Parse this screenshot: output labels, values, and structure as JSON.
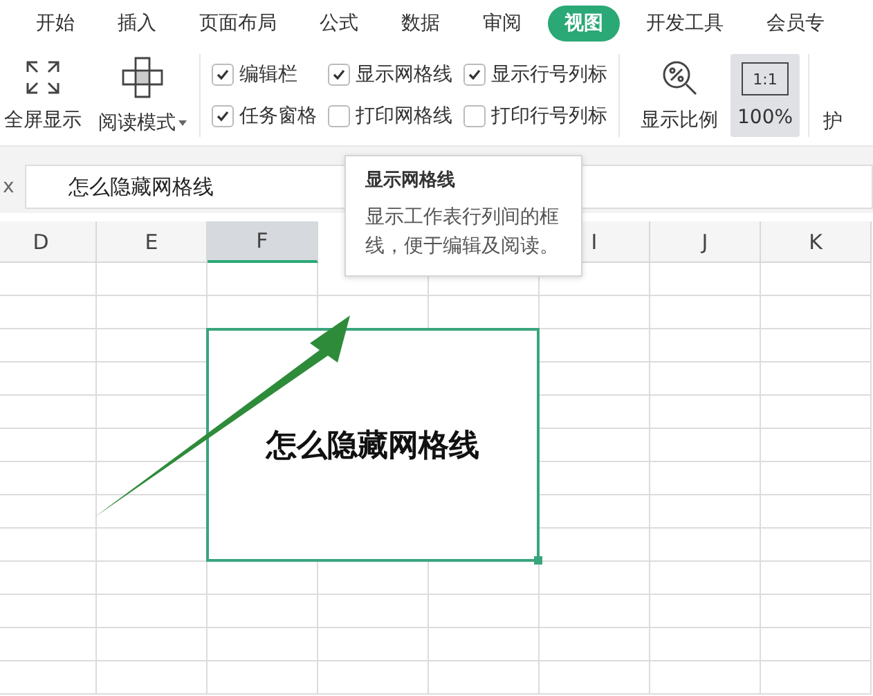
{
  "tabs": [
    {
      "label": "开始",
      "selected": false
    },
    {
      "label": "插入",
      "selected": false
    },
    {
      "label": "页面布局",
      "selected": false
    },
    {
      "label": "公式",
      "selected": false
    },
    {
      "label": "数据",
      "selected": false
    },
    {
      "label": "审阅",
      "selected": false
    },
    {
      "label": "视图",
      "selected": true
    },
    {
      "label": "开发工具",
      "selected": false
    },
    {
      "label": "会员专",
      "selected": false
    }
  ],
  "ribbon": {
    "fullscreen": {
      "label": "全屏显示"
    },
    "reading_mode": {
      "label": "阅读模式"
    },
    "checkboxes": [
      {
        "label": "编辑栏",
        "checked": true
      },
      {
        "label": "任务窗格",
        "checked": true
      },
      {
        "label": "显示网格线",
        "checked": true
      },
      {
        "label": "打印网格线",
        "checked": false
      },
      {
        "label": "显示行号列标",
        "checked": true
      },
      {
        "label": "打印行号列标",
        "checked": false
      }
    ],
    "zoom": {
      "label": "显示比例"
    },
    "actual_size": {
      "icon_text": "1:1",
      "label": "100%",
      "selected": true
    },
    "cut_item": {
      "label": "护"
    }
  },
  "formula_bar": {
    "fx_label": "x",
    "value": "怎么隐藏网格线"
  },
  "columns": [
    {
      "label": "D",
      "selected": false
    },
    {
      "label": "E",
      "selected": false
    },
    {
      "label": "F",
      "selected": true
    },
    null,
    null,
    {
      "label": "I",
      "selected": false
    },
    {
      "label": "J",
      "selected": false
    },
    {
      "label": "K",
      "selected": false
    }
  ],
  "merged_cell": {
    "value": "怎么隐藏网格线"
  },
  "tooltip": {
    "title": "显示网格线",
    "text": "显示工作表行列间的框线，便于编辑及阅读。"
  }
}
